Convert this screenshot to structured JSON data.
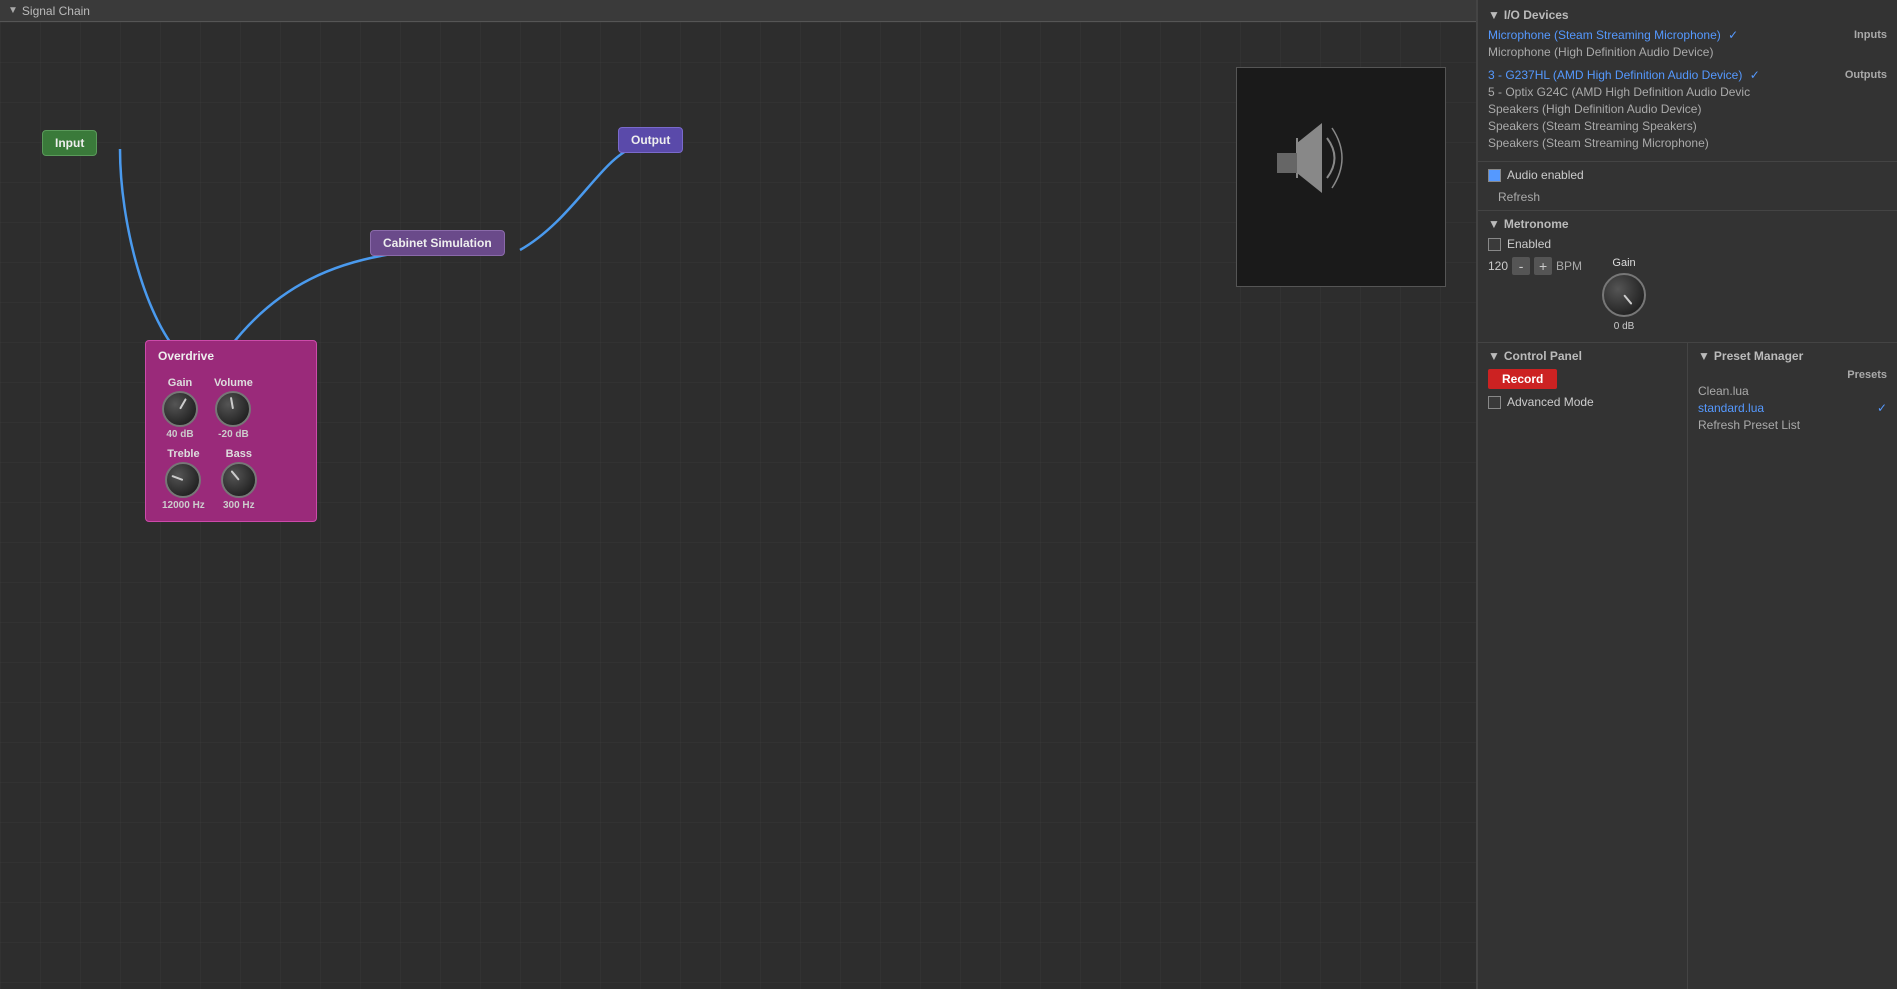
{
  "signalChain": {
    "title": "Signal Chain",
    "nodes": {
      "input": {
        "label": "Input"
      },
      "output": {
        "label": "Output"
      },
      "cabinet": {
        "label": "Cabinet Simulation"
      },
      "overdrive": {
        "label": "Overdrive",
        "gain": {
          "label": "Gain",
          "value": "40 dB",
          "rotation": 30
        },
        "volume": {
          "label": "Volume",
          "value": "-20 dB",
          "rotation": -10
        },
        "treble": {
          "label": "Treble",
          "value": "12000 Hz",
          "rotation": -70
        },
        "bass": {
          "label": "Bass",
          "value": "300 Hz",
          "rotation": -40
        }
      }
    }
  },
  "ioDevices": {
    "title": "I/O Devices",
    "inputs": {
      "label": "Inputs",
      "selected": "Microphone (Steam Streaming Microphone)",
      "unselected": "Microphone (High Definition Audio Device)"
    },
    "outputs": {
      "label": "Outputs",
      "selected": "3 - G237HL (AMD High Definition Audio Device)",
      "options": [
        "5 - Optix G24C (AMD High Definition Audio Devic",
        "Speakers (High Definition Audio Device)",
        "Speakers (Steam Streaming Speakers)",
        "Speakers (Steam Streaming Microphone)"
      ]
    },
    "audioEnabled": "Audio enabled",
    "refresh": "Refresh"
  },
  "metronome": {
    "title": "Metronome",
    "enabled": "Enabled",
    "bpmValue": "120",
    "bpmLabel": "BPM",
    "minusLabel": "-",
    "plusLabel": "+",
    "gainLabel": "Gain",
    "gainValue": "0 dB"
  },
  "controlPanel": {
    "title": "Control Panel",
    "recordLabel": "Record",
    "advancedModeLabel": "Advanced Mode"
  },
  "presetManager": {
    "title": "Preset Manager",
    "presetsLabel": "Presets",
    "presets": [
      {
        "name": "Clean.lua",
        "selected": false
      },
      {
        "name": "standard.lua",
        "selected": true
      }
    ],
    "refreshLabel": "Refresh Preset List"
  }
}
